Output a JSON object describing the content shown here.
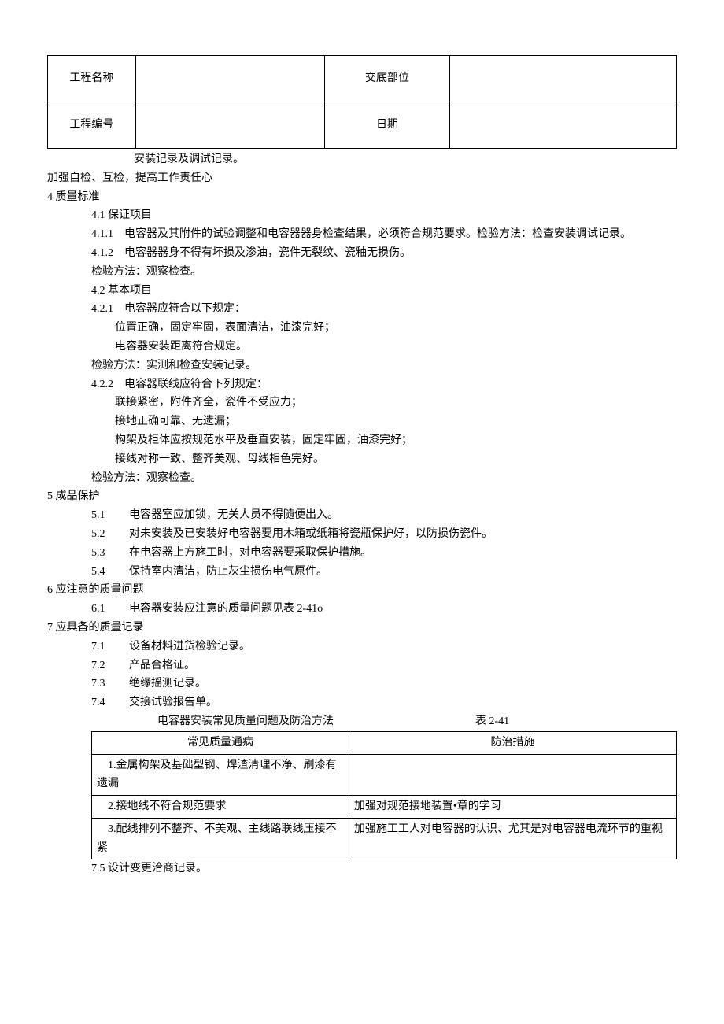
{
  "header": {
    "r1c1": "工程名称",
    "r1c2": "",
    "r1c3": "交底部位",
    "r1c4": "",
    "r2c1": "工程编号",
    "r2c2": "",
    "r2c3": "日期",
    "r2c4": ""
  },
  "line_install_record": "安装记录及调试记录。",
  "line_strengthen": "加强自检、互检，提高工作责任心",
  "sec4_heading": "4 质量标准",
  "s4_1": "4.1 保证项目",
  "s4_1_1": "4.1.1　电容器及其附件的试验调整和电容器器身检查结果，必须符合规范要求。检验方法：检查安装调试记录。",
  "s4_1_2": "4.1.2　电容器器身不得有坏损及渗油，瓷件无裂纹、瓷釉无损伤。",
  "s4_check1": "检验方法：观察检查。",
  "s4_2": "4.2 基本项目",
  "s4_2_1": "4.2.1　电容器应符合以下规定：",
  "s4_2_1_a": "位置正确，固定牢固，表面清洁，油漆完好；",
  "s4_2_1_b": "电容器安装距离符合规定。",
  "s4_check2": "检验方法：实测和检查安装记录。",
  "s4_2_2": "4.2.2　电容器联线应符合下列规定：",
  "s4_2_2_a": "联接紧密，附件齐全，瓷件不受应力；",
  "s4_2_2_b": "接地正确可靠、无遗漏；",
  "s4_2_2_c": "构架及柜体应按规范水平及垂直安装，固定牢固，油漆完好；",
  "s4_2_2_d": "接线对称一致、整齐美观、母线相色完好。",
  "s4_check3": "检验方法：观察检查。",
  "sec5_heading": "5 成品保护",
  "s5_1_num": "5.1",
  "s5_1_txt": "电容器室应加锁，无关人员不得随便出入。",
  "s5_2_num": "5.2",
  "s5_2_txt": "对未安装及已安装好电容器要用木箱或纸箱将瓷瓶保护好，以防损伤瓷件。",
  "s5_3_num": "5.3",
  "s5_3_txt": "在电容器上方施工时，对电容器要采取保护措施。",
  "s5_4_num": "5.4",
  "s5_4_txt": "保持室内清洁，防止灰尘损伤电气原件。",
  "sec6_heading": "6 应注意的质量问题",
  "s6_1_num": "6.1",
  "s6_1_txt": "电容器安装应注意的质量问题见表 2-41o",
  "sec7_heading": "7 应具备的质量记录",
  "s7_1_num": "7.1",
  "s7_1_txt": "设备材料进货检验记录。",
  "s7_2_num": "7.2",
  "s7_2_txt": "产品合格证。",
  "s7_3_num": "7.3",
  "s7_3_txt": "绝缘摇测记录。",
  "s7_4_num": "7.4",
  "s7_4_txt": "交接试验报告单。",
  "table_title_left": "电容器安装常见质量问题及防治方法",
  "table_title_right": "表 2-41",
  "qc_h1": "常见质量通病",
  "qc_h2": "防治措施",
  "qc_r1c1": "　1.金属构架及基础型钢、焊渣清理不净、刷漆有遗漏",
  "qc_r1c2": "",
  "qc_r2c1": "　2.接地线不符合规范要求",
  "qc_r2c2": "加强对规范接地装置•章的学习",
  "qc_r3c1": "　3.配线排列不整齐、不美观、主线路联线压接不紧",
  "qc_r3c2": "加强施工工人对电容器的认识、尤其是对电容器电流环节的重视",
  "s7_5": "7.5 设计变更洽商记录。"
}
